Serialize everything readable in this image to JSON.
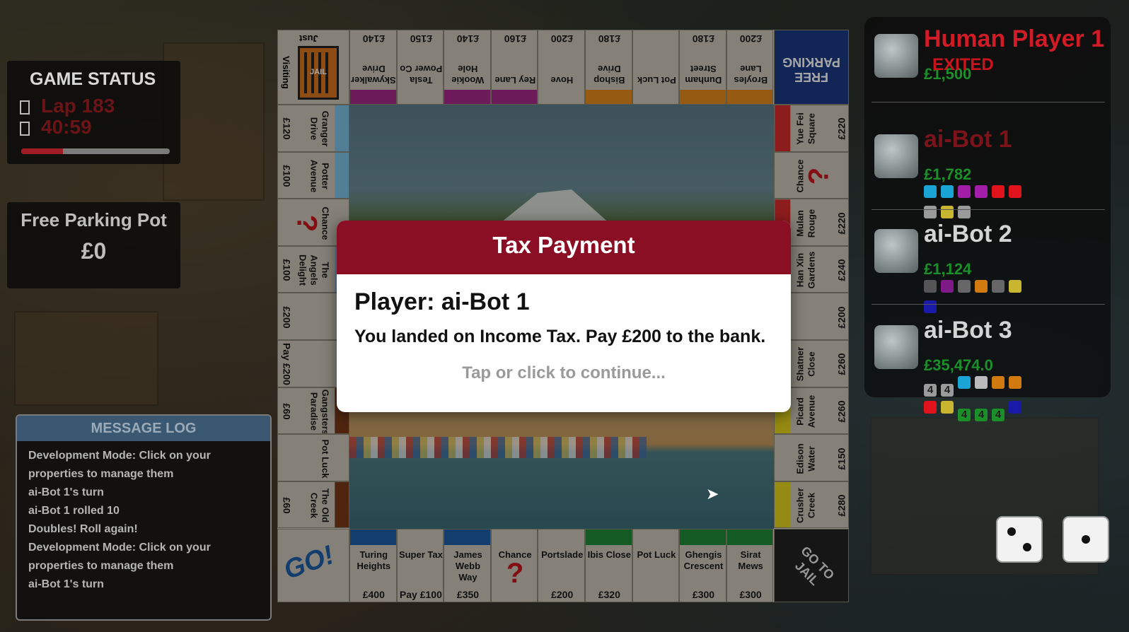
{
  "game_status": {
    "title": "GAME STATUS",
    "lap": "Lap 183",
    "time": "40:59",
    "progress_fraction": 0.28
  },
  "free_parking": {
    "title": "Free Parking Pot",
    "value": "£0"
  },
  "message_log": {
    "title": "MESSAGE LOG",
    "lines": [
      "Development Mode: Click on your",
      "properties to manage them",
      "ai-Bot 1's turn",
      "ai-Bot 1 rolled 10",
      "Doubles! Roll again!",
      "Development Mode: Click on your",
      "properties to manage them",
      "ai-Bot 1's turn"
    ]
  },
  "modal": {
    "title": "Tax Payment",
    "player": "Player: ai-Bot 1",
    "message": "You landed on Income Tax. Pay £200 to the bank.",
    "continue": "Tap or click to continue..."
  },
  "board": {
    "bottom": [
      {
        "name": "Turing Heights",
        "price": "£400",
        "color": "#1d5fa8"
      },
      {
        "name": "Super Tax",
        "price": "Pay £100",
        "color": ""
      },
      {
        "name": "James Webb Way",
        "price": "£350",
        "color": "#1d5fa8"
      },
      {
        "name": "Chance",
        "price": "",
        "color": ""
      },
      {
        "name": "Portslade",
        "price": "£200",
        "color": ""
      },
      {
        "name": "Ibis Close",
        "price": "£320",
        "color": "#1f8a3a"
      },
      {
        "name": "Pot Luck",
        "price": "",
        "color": ""
      },
      {
        "name": "Ghengis Crescent",
        "price": "£300",
        "color": "#1f8a3a"
      },
      {
        "name": "Sirat Mews",
        "price": "£300",
        "color": "#1f8a3a"
      }
    ],
    "top": [
      {
        "name": "Skywalker Drive",
        "price": "£140",
        "color": "#a8288c"
      },
      {
        "name": "Tesla Power Co",
        "price": "£150",
        "color": ""
      },
      {
        "name": "Wookie Hole",
        "price": "£140",
        "color": "#a8288c"
      },
      {
        "name": "Rey Lane",
        "price": "£160",
        "color": "#a8288c"
      },
      {
        "name": "Hove",
        "price": "£200",
        "color": ""
      },
      {
        "name": "Bishop Drive",
        "price": "£180",
        "color": "#e68a1c"
      },
      {
        "name": "Pot Luck",
        "price": "",
        "color": ""
      },
      {
        "name": "Dunham Street",
        "price": "£180",
        "color": "#e68a1c"
      },
      {
        "name": "Broyles Lane",
        "price": "£200",
        "color": "#e68a1c"
      }
    ],
    "left": [
      {
        "name": "Granger Drive",
        "price": "£120",
        "color": "#7fc3e6"
      },
      {
        "name": "Potter Avenue",
        "price": "£100",
        "color": "#7fc3e6"
      },
      {
        "name": "Chance",
        "price": "",
        "color": ""
      },
      {
        "name": "The Angels Delight",
        "price": "£100",
        "color": "#7fc3e6"
      },
      {
        "name": "",
        "price": "£200",
        "color": ""
      },
      {
        "name": "",
        "price": "Pay £200",
        "color": ""
      },
      {
        "name": "Gangsters Paradise",
        "price": "£60",
        "color": "#7a3a1a"
      },
      {
        "name": "Pot Luck",
        "price": "",
        "color": ""
      },
      {
        "name": "The Old Creek",
        "price": "£60",
        "color": "#7a3a1a"
      }
    ],
    "right": [
      {
        "name": "Yue Fei Square",
        "price": "£220",
        "color": "#d92b2b"
      },
      {
        "name": "Chance",
        "price": "",
        "color": ""
      },
      {
        "name": "Mulan Rouge",
        "price": "£220",
        "color": "#d92b2b"
      },
      {
        "name": "Han Xin Gardens",
        "price": "£240",
        "color": "#d92b2b"
      },
      {
        "name": "",
        "price": "£200",
        "color": ""
      },
      {
        "name": "Shatner Close",
        "price": "£260",
        "color": "#e6d61c"
      },
      {
        "name": "Picard Avenue",
        "price": "£260",
        "color": "#e6d61c"
      },
      {
        "name": "Edison Water",
        "price": "£150",
        "color": ""
      },
      {
        "name": "Crusher Creek",
        "price": "£280",
        "color": "#e6d61c"
      }
    ],
    "corner_go": "GO!",
    "corner_jail_top": "Just",
    "corner_jail_side": "Visiting",
    "corner_jail_label": "JAIL",
    "corner_parking": "FREE PARKING",
    "corner_gotojail": "GO TO JAIL"
  },
  "players": [
    {
      "name": "Human Player 1",
      "money": "£1,500",
      "note": "EXITED",
      "name_color": "#d11b26",
      "money_color": "#1c8f2a"
    },
    {
      "name": "ai-Bot 1",
      "money": "£1,782",
      "name_color": "#7a141a",
      "money_color": "#1c8f2a",
      "props": [
        [
          "",
          "#1aa4d6"
        ],
        [
          "",
          "#1aa4d6"
        ],
        [
          "",
          "#a21da8"
        ],
        [
          "",
          "#a21da8"
        ],
        [
          "",
          "#e0121b"
        ],
        [
          "",
          "#e0121b"
        ],
        [
          "",
          "#9a9a9a"
        ],
        [
          "",
          "#c8b530"
        ],
        [
          "",
          "#9a9a9a"
        ]
      ]
    },
    {
      "name": "ai-Bot 2",
      "money": "£1,124",
      "name_color": "#d4d4d4",
      "money_color": "#1c8f2a",
      "props": [
        [
          "",
          "#555555"
        ],
        [
          "",
          "#7e1a88"
        ],
        [
          "",
          "#666666"
        ],
        [
          "",
          "#d07a10"
        ],
        [
          "",
          "#666666"
        ],
        [
          "",
          "#c8b530"
        ],
        [
          "",
          "#1a1aa8"
        ]
      ]
    },
    {
      "name": "ai-Bot 3",
      "money": "£35,474.0",
      "name_color": "#d4d4d4",
      "money_color": "#1c8f2a",
      "props": [
        [
          "4",
          "#9a9a9a"
        ],
        [
          "4",
          "#9a9a9a"
        ],
        [
          "",
          "#1aa4d6"
        ],
        [
          "",
          "#bbbbbb"
        ],
        [
          "",
          "#d07a10"
        ],
        [
          "",
          "#d07a10"
        ],
        [
          "",
          "#e0121b"
        ],
        [
          "",
          "#c8b530"
        ],
        [
          "4",
          "#1c8f2a"
        ],
        [
          "4",
          "#1c8f2a"
        ],
        [
          "4",
          "#1c8f2a"
        ],
        [
          "",
          "#1a1aa8"
        ]
      ]
    }
  ],
  "dice": [
    2,
    1
  ],
  "icons": [
    "train-icon",
    "question-icon",
    "pot-luck-chest-icon",
    "lightbulb-icon",
    "water-tap-icon",
    "car-icon"
  ]
}
